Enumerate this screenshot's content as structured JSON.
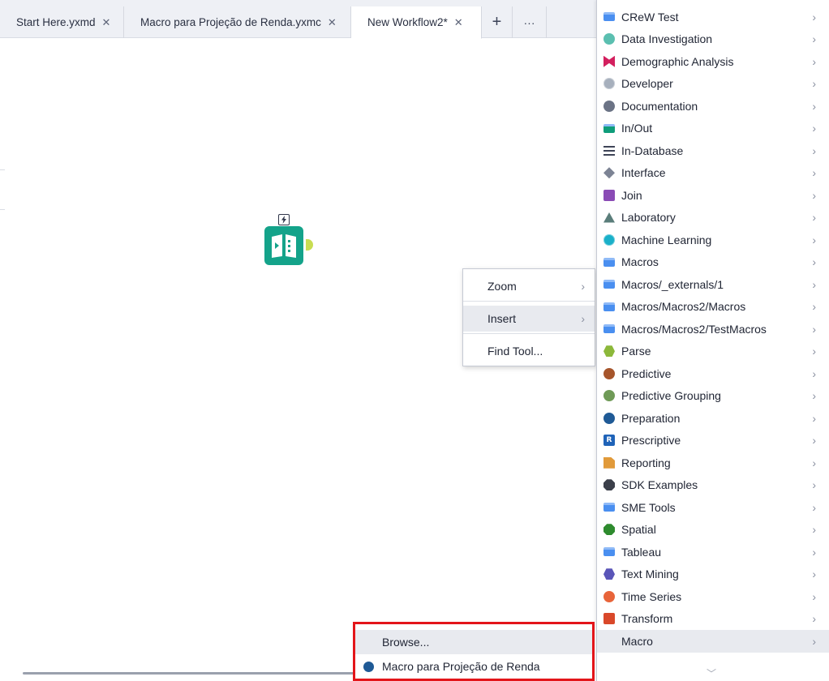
{
  "tabs": [
    {
      "label": "Start Here.yxmd",
      "close": "✕"
    },
    {
      "label": "Macro para Projeção de Renda.yxmc",
      "close": "✕"
    },
    {
      "label": "New Workflow2*",
      "close": "✕"
    }
  ],
  "tab_add": "+",
  "tab_more": "···",
  "context_menu": {
    "items": [
      {
        "label": "Zoom",
        "chevron": "›"
      },
      {
        "label": "Insert",
        "chevron": "›"
      },
      {
        "label": "Find Tool..."
      }
    ]
  },
  "categories": [
    {
      "label": "CReW Test",
      "icon": "folder-icon",
      "color": "#4a8ff0"
    },
    {
      "label": "Data Investigation",
      "icon": "circle-icon",
      "color": "#5bbfb0"
    },
    {
      "label": "Demographic Analysis",
      "icon": "bowtie-icon",
      "color": "#d31f5e"
    },
    {
      "label": "Developer",
      "icon": "gear-icon",
      "color": "#a7b0bd"
    },
    {
      "label": "Documentation",
      "icon": "speech-bubble-icon",
      "color": "#6b7385"
    },
    {
      "label": "In/Out",
      "icon": "folder-icon",
      "color": "#0f9d7a"
    },
    {
      "label": "In-Database",
      "icon": "lines-icon",
      "color": "#3e4457"
    },
    {
      "label": "Interface",
      "icon": "diamond-icon",
      "color": "#7c8394"
    },
    {
      "label": "Join",
      "icon": "square-icon",
      "color": "#8a4bb5"
    },
    {
      "label": "Laboratory",
      "icon": "triangle-icon",
      "color": "#5a7d7a"
    },
    {
      "label": "Machine Learning",
      "icon": "gear-icon",
      "color": "#1ab0c9"
    },
    {
      "label": "Macros",
      "icon": "folder-icon",
      "color": "#4a8ff0"
    },
    {
      "label": "Macros/_externals/1",
      "icon": "folder-icon",
      "color": "#4a8ff0"
    },
    {
      "label": "Macros/Macros2/Macros",
      "icon": "folder-icon",
      "color": "#4a8ff0"
    },
    {
      "label": "Macros/Macros2/TestMacros",
      "icon": "folder-icon",
      "color": "#4a8ff0"
    },
    {
      "label": "Parse",
      "icon": "hexagon-icon",
      "color": "#8cb83a"
    },
    {
      "label": "Predictive",
      "icon": "r-badge-icon",
      "color": "#a6552b"
    },
    {
      "label": "Predictive Grouping",
      "icon": "r-badge-icon",
      "color": "#6f9a57"
    },
    {
      "label": "Preparation",
      "icon": "circle-icon",
      "color": "#1f5a96"
    },
    {
      "label": "Prescriptive",
      "icon": "r-square-icon",
      "color": "#1f63b8"
    },
    {
      "label": "Reporting",
      "icon": "document-icon",
      "color": "#e19a3a"
    },
    {
      "label": "SDK Examples",
      "icon": "octagon-icon",
      "color": "#3b3f4a"
    },
    {
      "label": "SME Tools",
      "icon": "folder-icon",
      "color": "#4a8ff0"
    },
    {
      "label": "Spatial",
      "icon": "octagon-icon",
      "color": "#2e8b2e"
    },
    {
      "label": "Tableau",
      "icon": "folder-icon",
      "color": "#4a8ff0"
    },
    {
      "label": "Text Mining",
      "icon": "hexagon-icon",
      "color": "#5a55b8"
    },
    {
      "label": "Time Series",
      "icon": "r-circle-icon",
      "color": "#e8643a"
    },
    {
      "label": "Transform",
      "icon": "square-icon",
      "color": "#d9482a"
    },
    {
      "label": "Macro",
      "icon": "none"
    }
  ],
  "category_chevron": "›",
  "scroll_down": "﹀",
  "macro_submenu": {
    "browse_label": "Browse...",
    "macro_label": "Macro para Projeção de Renda",
    "highlight_color": "#e3151a"
  }
}
